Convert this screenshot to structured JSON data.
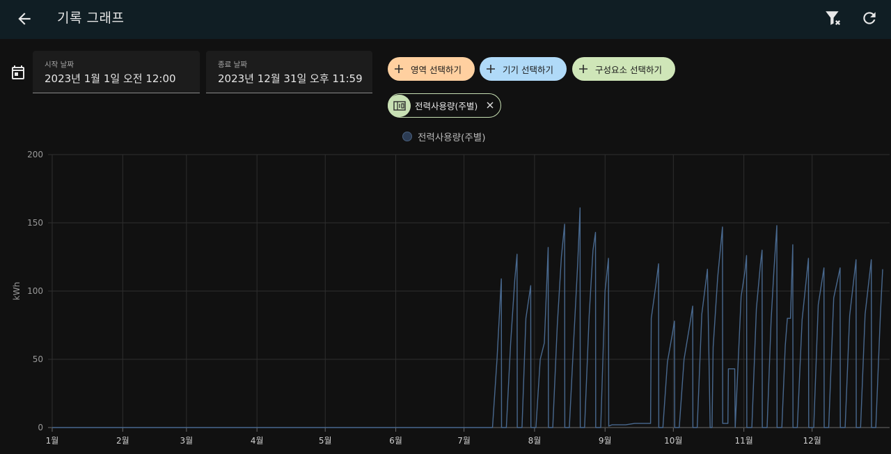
{
  "header": {
    "title": "기록 그래프",
    "back_icon": "arrow-back-icon",
    "filter_icon": "filter-remove-icon",
    "refresh_icon": "refresh-icon"
  },
  "date_range": {
    "start_label": "시작 날짜",
    "start_value": "2023년 1월 1일 오전 12:00",
    "end_label": "종료 날짜",
    "end_value": "2023년 12월 31일 오후 11:59",
    "calendar_icon": "calendar-icon"
  },
  "target_buttons": [
    {
      "label": "영역 선택하기",
      "color": "#ffd0a0"
    },
    {
      "label": "기기 선택하기",
      "color": "#b0daf8"
    },
    {
      "label": "구성요소 선택하기",
      "color": "#cfe6b8"
    }
  ],
  "selected_chip": {
    "label": "전력사용량(주별)",
    "icon": "counter-icon",
    "remove_icon": "close-icon",
    "color": "#c8e0b4"
  },
  "chart_data": {
    "type": "line",
    "title": "",
    "xlabel": "",
    "ylabel": "kWh",
    "ylim": [
      0,
      200
    ],
    "yticks": [
      0,
      50,
      100,
      150,
      200
    ],
    "grid": true,
    "legend_position": "top-center",
    "x_tick_labels": [
      "1월",
      "2월",
      "3월",
      "4월",
      "5월",
      "6월",
      "7월",
      "8월",
      "9월",
      "10월",
      "11월",
      "12월"
    ],
    "x_tick_days": [
      0,
      31,
      59,
      90,
      120,
      151,
      181,
      212,
      243,
      273,
      304,
      334
    ],
    "x_range_days": [
      0,
      365
    ],
    "series": [
      {
        "name": "전력사용량(주별)",
        "color": "#49698f",
        "points": [
          [
            0,
            0
          ],
          [
            193.5,
            0
          ],
          [
            195.5,
            50
          ],
          [
            197.4,
            109
          ],
          [
            197.5,
            0
          ],
          [
            199.6,
            0
          ],
          [
            201.5,
            62
          ],
          [
            203.3,
            108
          ],
          [
            204.3,
            127
          ],
          [
            204.4,
            0
          ],
          [
            206.5,
            0
          ],
          [
            208.2,
            80
          ],
          [
            210.3,
            104
          ],
          [
            210.4,
            0
          ],
          [
            212.6,
            0
          ],
          [
            214.5,
            50
          ],
          [
            216.3,
            62
          ],
          [
            218,
            132
          ],
          [
            218.1,
            0
          ],
          [
            220,
            0
          ],
          [
            222,
            75
          ],
          [
            223.8,
            125
          ],
          [
            225.2,
            149
          ],
          [
            225.3,
            0
          ],
          [
            227.3,
            0
          ],
          [
            229.2,
            63
          ],
          [
            231,
            121
          ],
          [
            232,
            161
          ],
          [
            232.1,
            0
          ],
          [
            234,
            0
          ],
          [
            236,
            82
          ],
          [
            237.7,
            130
          ],
          [
            238.8,
            143
          ],
          [
            238.9,
            0
          ],
          [
            241.1,
            0
          ],
          [
            243,
            100
          ],
          [
            244.5,
            124
          ],
          [
            244.6,
            1
          ],
          [
            246,
            2
          ],
          [
            252,
            2
          ],
          [
            256,
            3
          ],
          [
            263,
            3
          ],
          [
            263.3,
            80
          ],
          [
            265.3,
            104
          ],
          [
            266.5,
            120
          ],
          [
            266.6,
            0
          ],
          [
            268.4,
            0
          ],
          [
            270.4,
            48
          ],
          [
            272.5,
            68
          ],
          [
            273.5,
            78
          ],
          [
            273.6,
            0
          ],
          [
            275.6,
            0
          ],
          [
            277.7,
            50
          ],
          [
            280,
            73
          ],
          [
            281.5,
            89
          ],
          [
            281.6,
            0
          ],
          [
            283.5,
            0
          ],
          [
            285.5,
            83
          ],
          [
            288,
            116
          ],
          [
            289.2,
            0
          ],
          [
            290,
            0
          ],
          [
            290.5,
            59
          ],
          [
            292.5,
            110
          ],
          [
            294.6,
            147
          ],
          [
            294.7,
            3
          ],
          [
            297,
            3
          ],
          [
            297.2,
            43
          ],
          [
            300,
            43
          ],
          [
            300.2,
            0
          ],
          [
            302.8,
            96
          ],
          [
            304.5,
            115
          ],
          [
            305.2,
            126
          ],
          [
            305.3,
            0
          ],
          [
            307.5,
            0
          ],
          [
            309.5,
            87
          ],
          [
            311.3,
            120
          ],
          [
            312,
            130
          ],
          [
            312.1,
            0
          ],
          [
            314.2,
            0
          ],
          [
            316,
            79
          ],
          [
            317.2,
            115
          ],
          [
            318.5,
            148
          ],
          [
            318.6,
            0
          ],
          [
            320.7,
            0
          ],
          [
            322.2,
            60
          ],
          [
            323.1,
            80
          ],
          [
            324.5,
            80
          ],
          [
            325.5,
            134
          ],
          [
            325.6,
            0
          ],
          [
            327.5,
            0
          ],
          [
            329.6,
            79
          ],
          [
            332.4,
            124
          ],
          [
            332.5,
            0
          ],
          [
            334.7,
            0
          ],
          [
            336.7,
            90
          ],
          [
            339.2,
            117
          ],
          [
            339.3,
            0
          ],
          [
            341.3,
            0
          ],
          [
            343.5,
            95
          ],
          [
            346.3,
            117
          ],
          [
            346.4,
            0
          ],
          [
            348.5,
            0
          ],
          [
            350.5,
            82
          ],
          [
            353.3,
            123
          ],
          [
            353.4,
            0
          ],
          [
            355.3,
            0
          ],
          [
            357.3,
            83
          ],
          [
            360,
            123
          ],
          [
            360.1,
            0
          ],
          [
            362,
            0
          ],
          [
            364,
            82
          ],
          [
            365,
            116
          ]
        ]
      }
    ]
  }
}
